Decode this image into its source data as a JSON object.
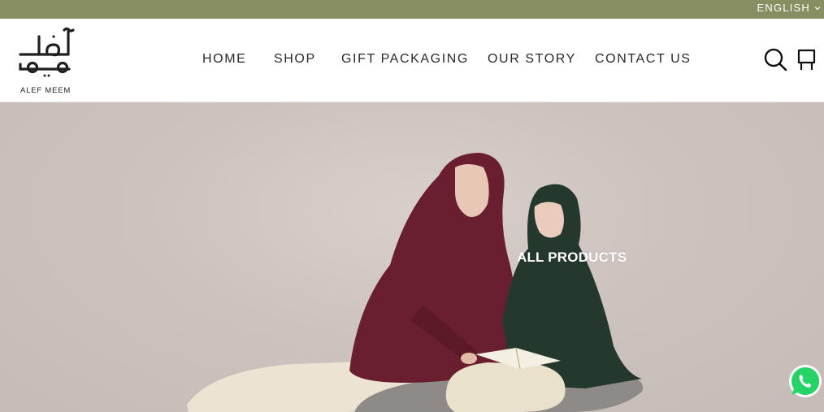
{
  "topbar": {
    "language": "ENGLISH",
    "background_color": "#878e62"
  },
  "header": {
    "logo_text": "ALEF MEEM",
    "logo_arabic": "ألف ميم",
    "nav": [
      {
        "label": "HOME"
      },
      {
        "label": "SHOP"
      },
      {
        "label": "GIFT PACKAGING"
      },
      {
        "label": "OUR STORY"
      },
      {
        "label": "CONTACT US"
      }
    ],
    "icons": [
      "search-icon",
      "cart-icon"
    ]
  },
  "hero": {
    "title": "ALL PRODUCTS",
    "background_color": "#cdc3be"
  },
  "floating": {
    "icon": "whatsapp-icon",
    "color": "#25d366"
  }
}
